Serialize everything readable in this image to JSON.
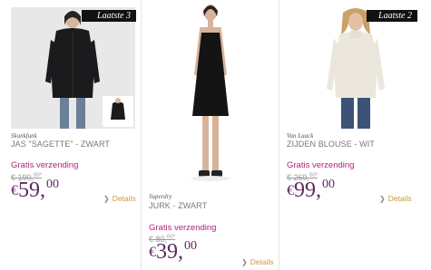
{
  "products": [
    {
      "badge": "Laatste 3",
      "brand": "Skunkfunk",
      "name": "JAS \"SAGETTE\" - ZWART",
      "shipping": "Gratis verzending",
      "old_price_main": "€ 190,",
      "old_price_sup": "00",
      "old_price_star": "*",
      "currency": "€",
      "price_euros": "59,",
      "price_cents": "00",
      "details": "Details",
      "details_icon": "chevron-right-icon"
    },
    {
      "badge": "",
      "brand": "Superdry",
      "name": "JURK - ZWART",
      "shipping": "Gratis verzending",
      "old_price_main": "€ 80,",
      "old_price_sup": "00",
      "old_price_star": "*",
      "currency": "€",
      "price_euros": "39,",
      "price_cents": "00",
      "details": "Details",
      "details_icon": "chevron-right-icon"
    },
    {
      "badge": "Laatste 2",
      "brand": "Van Laack",
      "name": "ZIJDEN BLOUSE - WIT",
      "shipping": "Gratis verzending",
      "old_price_main": "€ 269,",
      "old_price_sup": "00",
      "old_price_star": "*",
      "currency": "€",
      "price_euros": "99,",
      "price_cents": "00",
      "details": "Details",
      "details_icon": "chevron-right-icon"
    }
  ],
  "colors": {
    "shipping": "#b5217a",
    "price": "#5b2a5e",
    "details": "#c89a3c",
    "badge_bg": "#111111"
  }
}
